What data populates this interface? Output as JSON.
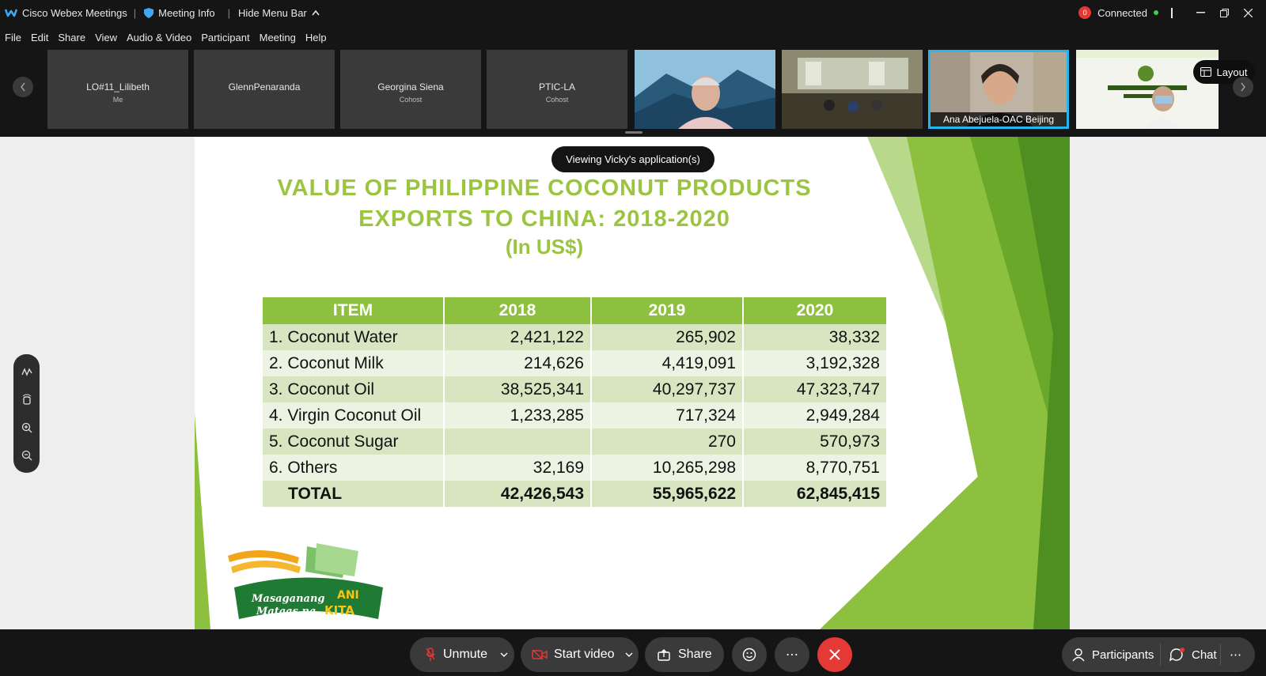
{
  "titlebar": {
    "app_name": "Cisco Webex Meetings",
    "meeting_info": "Meeting Info",
    "hide_menu_bar": "Hide Menu Bar",
    "rec_count": "0",
    "status": "Connected"
  },
  "menu": [
    "File",
    "Edit",
    "Share",
    "View",
    "Audio & Video",
    "Participant",
    "Meeting",
    "Help"
  ],
  "participants": [
    {
      "name": "LO#11_Lilibeth",
      "role": "Me"
    },
    {
      "name": "GlennPenaranda",
      "role": ""
    },
    {
      "name": "Georgina Siena",
      "role": "Cohost"
    },
    {
      "name": "PTIC-LA",
      "role": "Cohost"
    }
  ],
  "active_speaker": "Ana Abejuela-OAC Beijing",
  "layout_label": "Layout",
  "toast": "Viewing Vicky's application(s)",
  "slide": {
    "title_line1": "VALUE  OF PHILIPPINE COCONUT PRODUCTS",
    "title_line2": "EXPORTS TO CHINA: 2018-2020",
    "subtitle": "(In US$)",
    "headers": [
      "ITEM",
      "2018",
      "2019",
      "2020"
    ],
    "rows": [
      [
        "1. Coconut Water",
        "2,421,122",
        "265,902",
        "38,332"
      ],
      [
        "2. Coconut Milk",
        "214,626",
        "4,419,091",
        "3,192,328"
      ],
      [
        "3. Coconut Oil",
        "38,525,341",
        "40,297,737",
        "47,323,747"
      ],
      [
        "4. Virgin Coconut Oil",
        "1,233,285",
        "717,324",
        "2,949,284"
      ],
      [
        "5. Coconut Sugar",
        "",
        "270",
        "570,973"
      ],
      [
        "6. Others",
        "32,169",
        "10,265,298",
        "8,770,751"
      ]
    ],
    "total": [
      "TOTAL",
      "42,426,543",
      "55,965,622",
      "62,845,415"
    ],
    "logo_line1": "Masaganang",
    "logo_word1": "ANI",
    "logo_line2": "Mataas na",
    "logo_word2": "KITA"
  },
  "controls": {
    "unmute": "Unmute",
    "start_video": "Start video",
    "share": "Share",
    "participants": "Participants",
    "chat": "Chat",
    "more": "⋯"
  },
  "colors": {
    "slide_green": "#9bc541",
    "header_green": "#8dc03f",
    "end_red": "#e53935",
    "active_border": "#26b5ec"
  }
}
